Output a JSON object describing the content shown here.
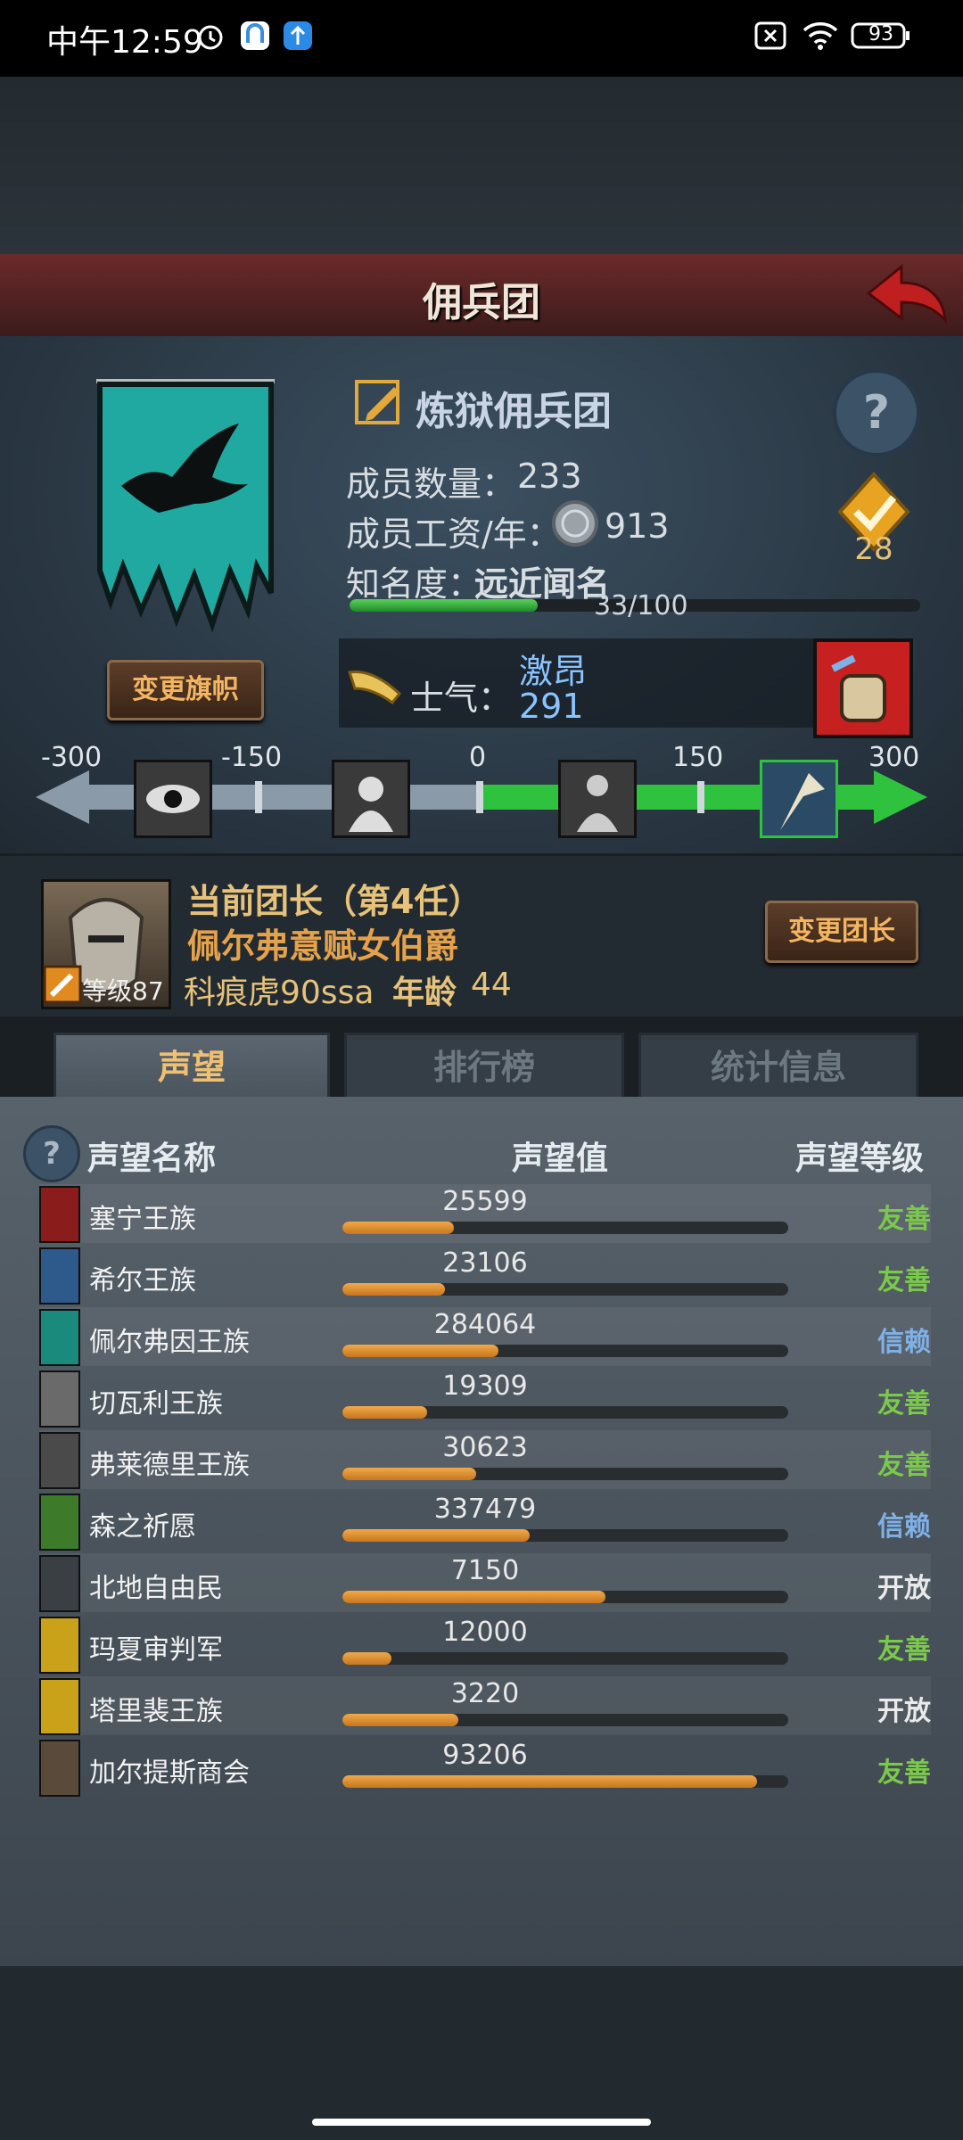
{
  "status_bar": {
    "time": "中午12:59",
    "battery": "93"
  },
  "header": {
    "title": "佣兵团"
  },
  "company": {
    "name": "炼狱佣兵团",
    "member_count_label": "成员数量：",
    "member_count": "233",
    "salary_label": "成员工资/年：",
    "salary": "913",
    "fame_label": "知名度：",
    "fame_value": "远近闻名",
    "fame_progress_text": "33/100",
    "fame_progress": 0.33,
    "badge_number": "28",
    "change_banner_label": "变更旗帜"
  },
  "morale": {
    "label": "士气：",
    "state": "激昂",
    "value": "291",
    "scale_ticks": [
      "-300",
      "-150",
      "0",
      "150",
      "300"
    ]
  },
  "leader": {
    "title": "当前团长（第4任）",
    "name": "佩尔弗意赋女伯爵",
    "level_label": "等级87",
    "class_name": "科痕虎90ssa",
    "age_label": "年龄",
    "age": "44",
    "change_leader_label": "变更团长"
  },
  "tabs": [
    {
      "label": "声望",
      "active": true
    },
    {
      "label": "排行榜",
      "active": false
    },
    {
      "label": "统计信息",
      "active": false
    }
  ],
  "reputation_table": {
    "headers": {
      "name": "声望名称",
      "value": "声望值",
      "level": "声望等级"
    },
    "rows": [
      {
        "name": "塞宁王族",
        "value": "25599",
        "fill": 0.25,
        "level": "友善",
        "level_color": "#7bc94a",
        "crest_color": "#8b1c1c"
      },
      {
        "name": "希尔王族",
        "value": "23106",
        "fill": 0.23,
        "level": "友善",
        "level_color": "#7bc94a",
        "crest_color": "#2d5a8a"
      },
      {
        "name": "佩尔弗因王族",
        "value": "284064",
        "fill": 0.35,
        "level": "信赖",
        "level_color": "#7fb0e6",
        "crest_color": "#1a8a7c"
      },
      {
        "name": "切瓦利王族",
        "value": "19309",
        "fill": 0.19,
        "level": "友善",
        "level_color": "#7bc94a",
        "crest_color": "#6a6a6a"
      },
      {
        "name": "弗莱德里王族",
        "value": "30623",
        "fill": 0.3,
        "level": "友善",
        "level_color": "#7bc94a",
        "crest_color": "#4a4a4a"
      },
      {
        "name": "森之祈愿",
        "value": "337479",
        "fill": 0.42,
        "level": "信赖",
        "level_color": "#7fb0e6",
        "crest_color": "#3d7a2a"
      },
      {
        "name": "北地自由民",
        "value": "7150",
        "fill": 0.59,
        "level": "开放",
        "level_color": "#eaeaea",
        "crest_color": "#3a3f44"
      },
      {
        "name": "玛夏审判军",
        "value": "12000",
        "fill": 0.11,
        "level": "友善",
        "level_color": "#7bc94a",
        "crest_color": "#c9a21a"
      },
      {
        "name": "塔里裴王族",
        "value": "3220",
        "fill": 0.26,
        "level": "开放",
        "level_color": "#eaeaea",
        "crest_color": "#c9a21a"
      },
      {
        "name": "加尔提斯商会",
        "value": "93206",
        "fill": 0.93,
        "level": "友善",
        "level_color": "#7bc94a",
        "crest_color": "#5a4a3a"
      }
    ]
  }
}
